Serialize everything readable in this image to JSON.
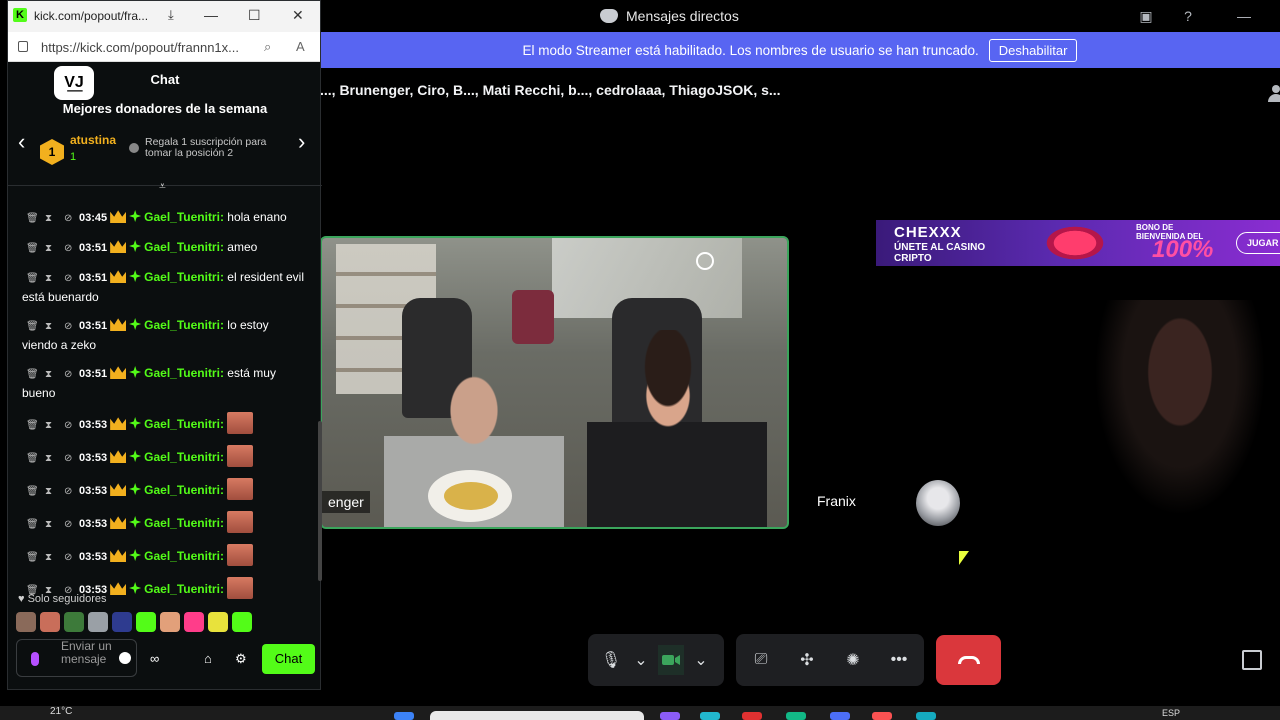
{
  "discord": {
    "window_title": "Mensajes directos",
    "banner": {
      "text": "El modo Streamer está habilitado. Los nombres de usuario se han truncado.",
      "button": "Deshabilitar"
    },
    "participants": "..., Brunenger, Ciro, B..., Mati Recchi, b..., cedrolaaa, ThiagoJSOK, s...",
    "main_video_name": "enger",
    "tile_name": "Franix",
    "ad": {
      "brand": "CHEXXX",
      "tagline": "ÚNETE AL CASINO CRIPTO",
      "bonus": "BONO DE BIENVENIDA DEL",
      "bonus_value": "100%",
      "cta": "JUGAR"
    },
    "controls": [
      "microphone-icon",
      "chevron-down-icon",
      "camera-icon",
      "chevron-down-icon",
      "screen-share-icon",
      "activities-icon",
      "soundboard-icon",
      "more-icon",
      "hangup-icon"
    ],
    "accent": "#5865f2",
    "hangup_color": "#da373c"
  },
  "taskbar": {
    "temperature": "21°C",
    "language": "ESP"
  },
  "kick": {
    "tab_title": "kick.com/popout/fra...",
    "url": "https://kick.com/popout/frannn1x...",
    "header": "Chat",
    "channel_logo": "V͟J",
    "top_donors_title": "Mejores donadores de la semana",
    "donor": {
      "rank": "1",
      "name": "atustina",
      "count": "1",
      "hint": "Regala 1 suscripción para tomar la posición 2"
    },
    "messages": [
      {
        "time": "03:45",
        "user": "Gael_Tuenitri:",
        "text": "hola enano",
        "emote": false
      },
      {
        "time": "03:51",
        "user": "Gael_Tuenitri:",
        "text": "ameo",
        "emote": false
      },
      {
        "time": "03:51",
        "user": "Gael_Tuenitri:",
        "text": "el resident evil está buenardo",
        "emote": false
      },
      {
        "time": "03:51",
        "user": "Gael_Tuenitri:",
        "text": "lo estoy viendo a zeko",
        "emote": false
      },
      {
        "time": "03:51",
        "user": "Gael_Tuenitri:",
        "text": "está muy bueno",
        "emote": false
      },
      {
        "time": "03:53",
        "user": "Gael_Tuenitri:",
        "text": "",
        "emote": true
      },
      {
        "time": "03:53",
        "user": "Gael_Tuenitri:",
        "text": "",
        "emote": true
      },
      {
        "time": "03:53",
        "user": "Gael_Tuenitri:",
        "text": "",
        "emote": true
      },
      {
        "time": "03:53",
        "user": "Gael_Tuenitri:",
        "text": "",
        "emote": true
      },
      {
        "time": "03:53",
        "user": "Gael_Tuenitri:",
        "text": "",
        "emote": true
      },
      {
        "time": "03:53",
        "user": "Gael_Tuenitri:",
        "text": "",
        "emote": true
      }
    ],
    "followers_only": "Solo seguidores",
    "input_placeholder": "Enviar un mensaje",
    "chat_button": "Chat",
    "brand_color": "#53fc18",
    "username_color": "#53fc18",
    "badge_color": "#f2b01e"
  }
}
